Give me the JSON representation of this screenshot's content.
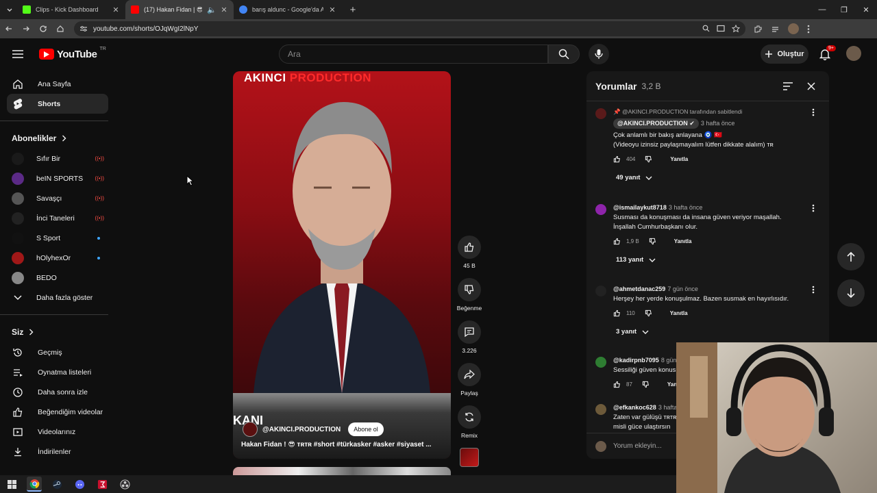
{
  "browser": {
    "tabs": [
      {
        "title": "Clips - Kick Dashboard",
        "favicon_color": "#53fc18",
        "active": false
      },
      {
        "title": "(17) Hakan Fidan | 😎 ᴛʀᴛʀ #",
        "favicon_color": "#ff0000",
        "active": true
      },
      {
        "title": "barış aldunc - Google'da Ara",
        "favicon_color": "#4285f4",
        "active": false
      }
    ],
    "new_tab": "+",
    "url": "youtube.com/shorts/OJqWgI2lNpY"
  },
  "masthead": {
    "logo_text": "YouTube",
    "logo_region": "TR",
    "search_placeholder": "Ara",
    "create_label": "Oluştur",
    "notifications_badge": "9+"
  },
  "sidebar": {
    "main": [
      {
        "label": "Ana Sayfa",
        "icon": "home-icon"
      },
      {
        "label": "Shorts",
        "icon": "shorts-icon",
        "active": true
      }
    ],
    "subscriptions_title": "Abonelikler",
    "subscriptions": [
      {
        "name": "Sıfır Bir",
        "color": "#1a1a1a",
        "status": "live"
      },
      {
        "name": "beIN SPORTS Tü...",
        "color": "#5b2a86",
        "status": "live"
      },
      {
        "name": "Savaşçı",
        "color": "#555555",
        "status": "live"
      },
      {
        "name": "İnci Taneleri",
        "color": "#222222",
        "status": "live"
      },
      {
        "name": "S Sport",
        "color": "#111111",
        "status": "new"
      },
      {
        "name": "hOlyhexOr",
        "color": "#a01818",
        "status": "new"
      },
      {
        "name": "BEDO",
        "color": "#888888",
        "status": "none"
      }
    ],
    "show_more": "Daha fazla göster",
    "you_title": "Siz",
    "you_items": [
      {
        "label": "Geçmiş",
        "icon": "history-icon"
      },
      {
        "label": "Oynatma listeleri",
        "icon": "playlist-icon"
      },
      {
        "label": "Daha sonra izle",
        "icon": "clock-icon"
      },
      {
        "label": "Beğendiğim videolar",
        "icon": "thumb-up-icon"
      },
      {
        "label": "Videolarınız",
        "icon": "video-icon"
      },
      {
        "label": "İndirilenler",
        "icon": "download-icon"
      }
    ]
  },
  "short": {
    "brand_a": "AKINCI",
    "brand_b": " PRODUCTION",
    "overlay_text": "KANI",
    "channel": "@AKINCI.PRODUCTION",
    "subscribe_label": "Abone ol",
    "title": "Hakan Fidan ! 😎 ᴛʀᴛʀ #short #türkasker #asker #siyaset ...",
    "likes": "45 B",
    "dislike_label": "Beğenme",
    "comments_count": "3.226",
    "share_label": "Paylaş",
    "remix_label": "Remix"
  },
  "comments": {
    "title": "Yorumlar",
    "count": "3,2 B",
    "input_placeholder": "Yorum ekleyin...",
    "reply_label": "Yanıtla",
    "pinned_text": "@AKINCI.PRODUCTION tarafından sabitlendi",
    "items": [
      {
        "author": "@AKINCI.PRODUCTION",
        "time": "3 hafta önce",
        "line1": "Çok anlamlı bir bakış anlayana 🧿 🇹🇷",
        "line2": "(Videoyu izinsiz paylaşmayalım lütfen dikkate alalım) ᴛʀ",
        "likes": "404",
        "replies": "49 yanıt",
        "avatar_color": "#5a1a1a"
      },
      {
        "author": "@ismailaykut8718",
        "time": "3 hafta önce",
        "line1": "Susması da konuşması da insana güven veriyor maşallah.",
        "line2": "İnşallah Cumhurbaşkanı olur.",
        "likes": "1,9 B",
        "replies": "113 yanıt",
        "avatar_color": "#8e24aa"
      },
      {
        "author": "@ahmetdanac259",
        "time": "7 gün önce",
        "line1": "Herşey her yerde konuşulmaz. Bazen susmak en hayırlısıdır.",
        "line2": "",
        "likes": "110",
        "replies": "3 yanıt",
        "avatar_color": "#222222"
      },
      {
        "author": "@kadirpnb7095",
        "time": "8 gün önce",
        "line1": "Sessiliği güven konusu",
        "line2": "",
        "likes": "87",
        "replies": "",
        "avatar_color": "#2e7d32"
      },
      {
        "author": "@efkankoc628",
        "time": "3 hafta önce",
        "line1": "Zaten var gülüşü ᴛʀᴛʀ",
        "line2": "misli güce ulaştırsın",
        "likes": "",
        "replies": "",
        "avatar_color": "#6d5a3a"
      }
    ]
  }
}
